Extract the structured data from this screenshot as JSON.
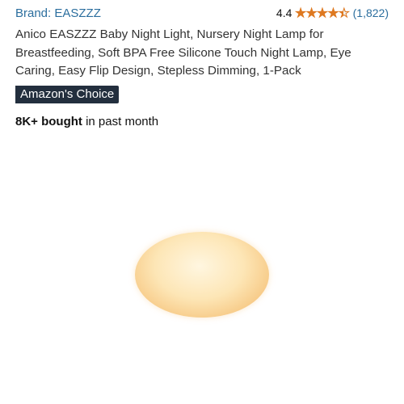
{
  "product": {
    "brand_label": "Brand: EASZZZ",
    "rating_value": "4.4",
    "rating_fraction": 0.88,
    "stars_glyphs": "★★★★★",
    "review_count": "(1,822)",
    "title": "Anico EASZZZ Baby Night Light, Nursery Night Lamp for Breastfeeding, Soft BPA Free Silicone Touch Night Lamp, Eye Caring, Easy Flip Design, Stepless Dimming, 1-Pack",
    "badge": "Amazon's Choice",
    "bought_bold": "8K+ bought",
    "bought_rest": " in past month"
  },
  "colors": {
    "link": "#2b6e9e",
    "star": "#de7921",
    "badge_bg": "#232f3e"
  },
  "image": {
    "icon": "night-light-product-image"
  }
}
